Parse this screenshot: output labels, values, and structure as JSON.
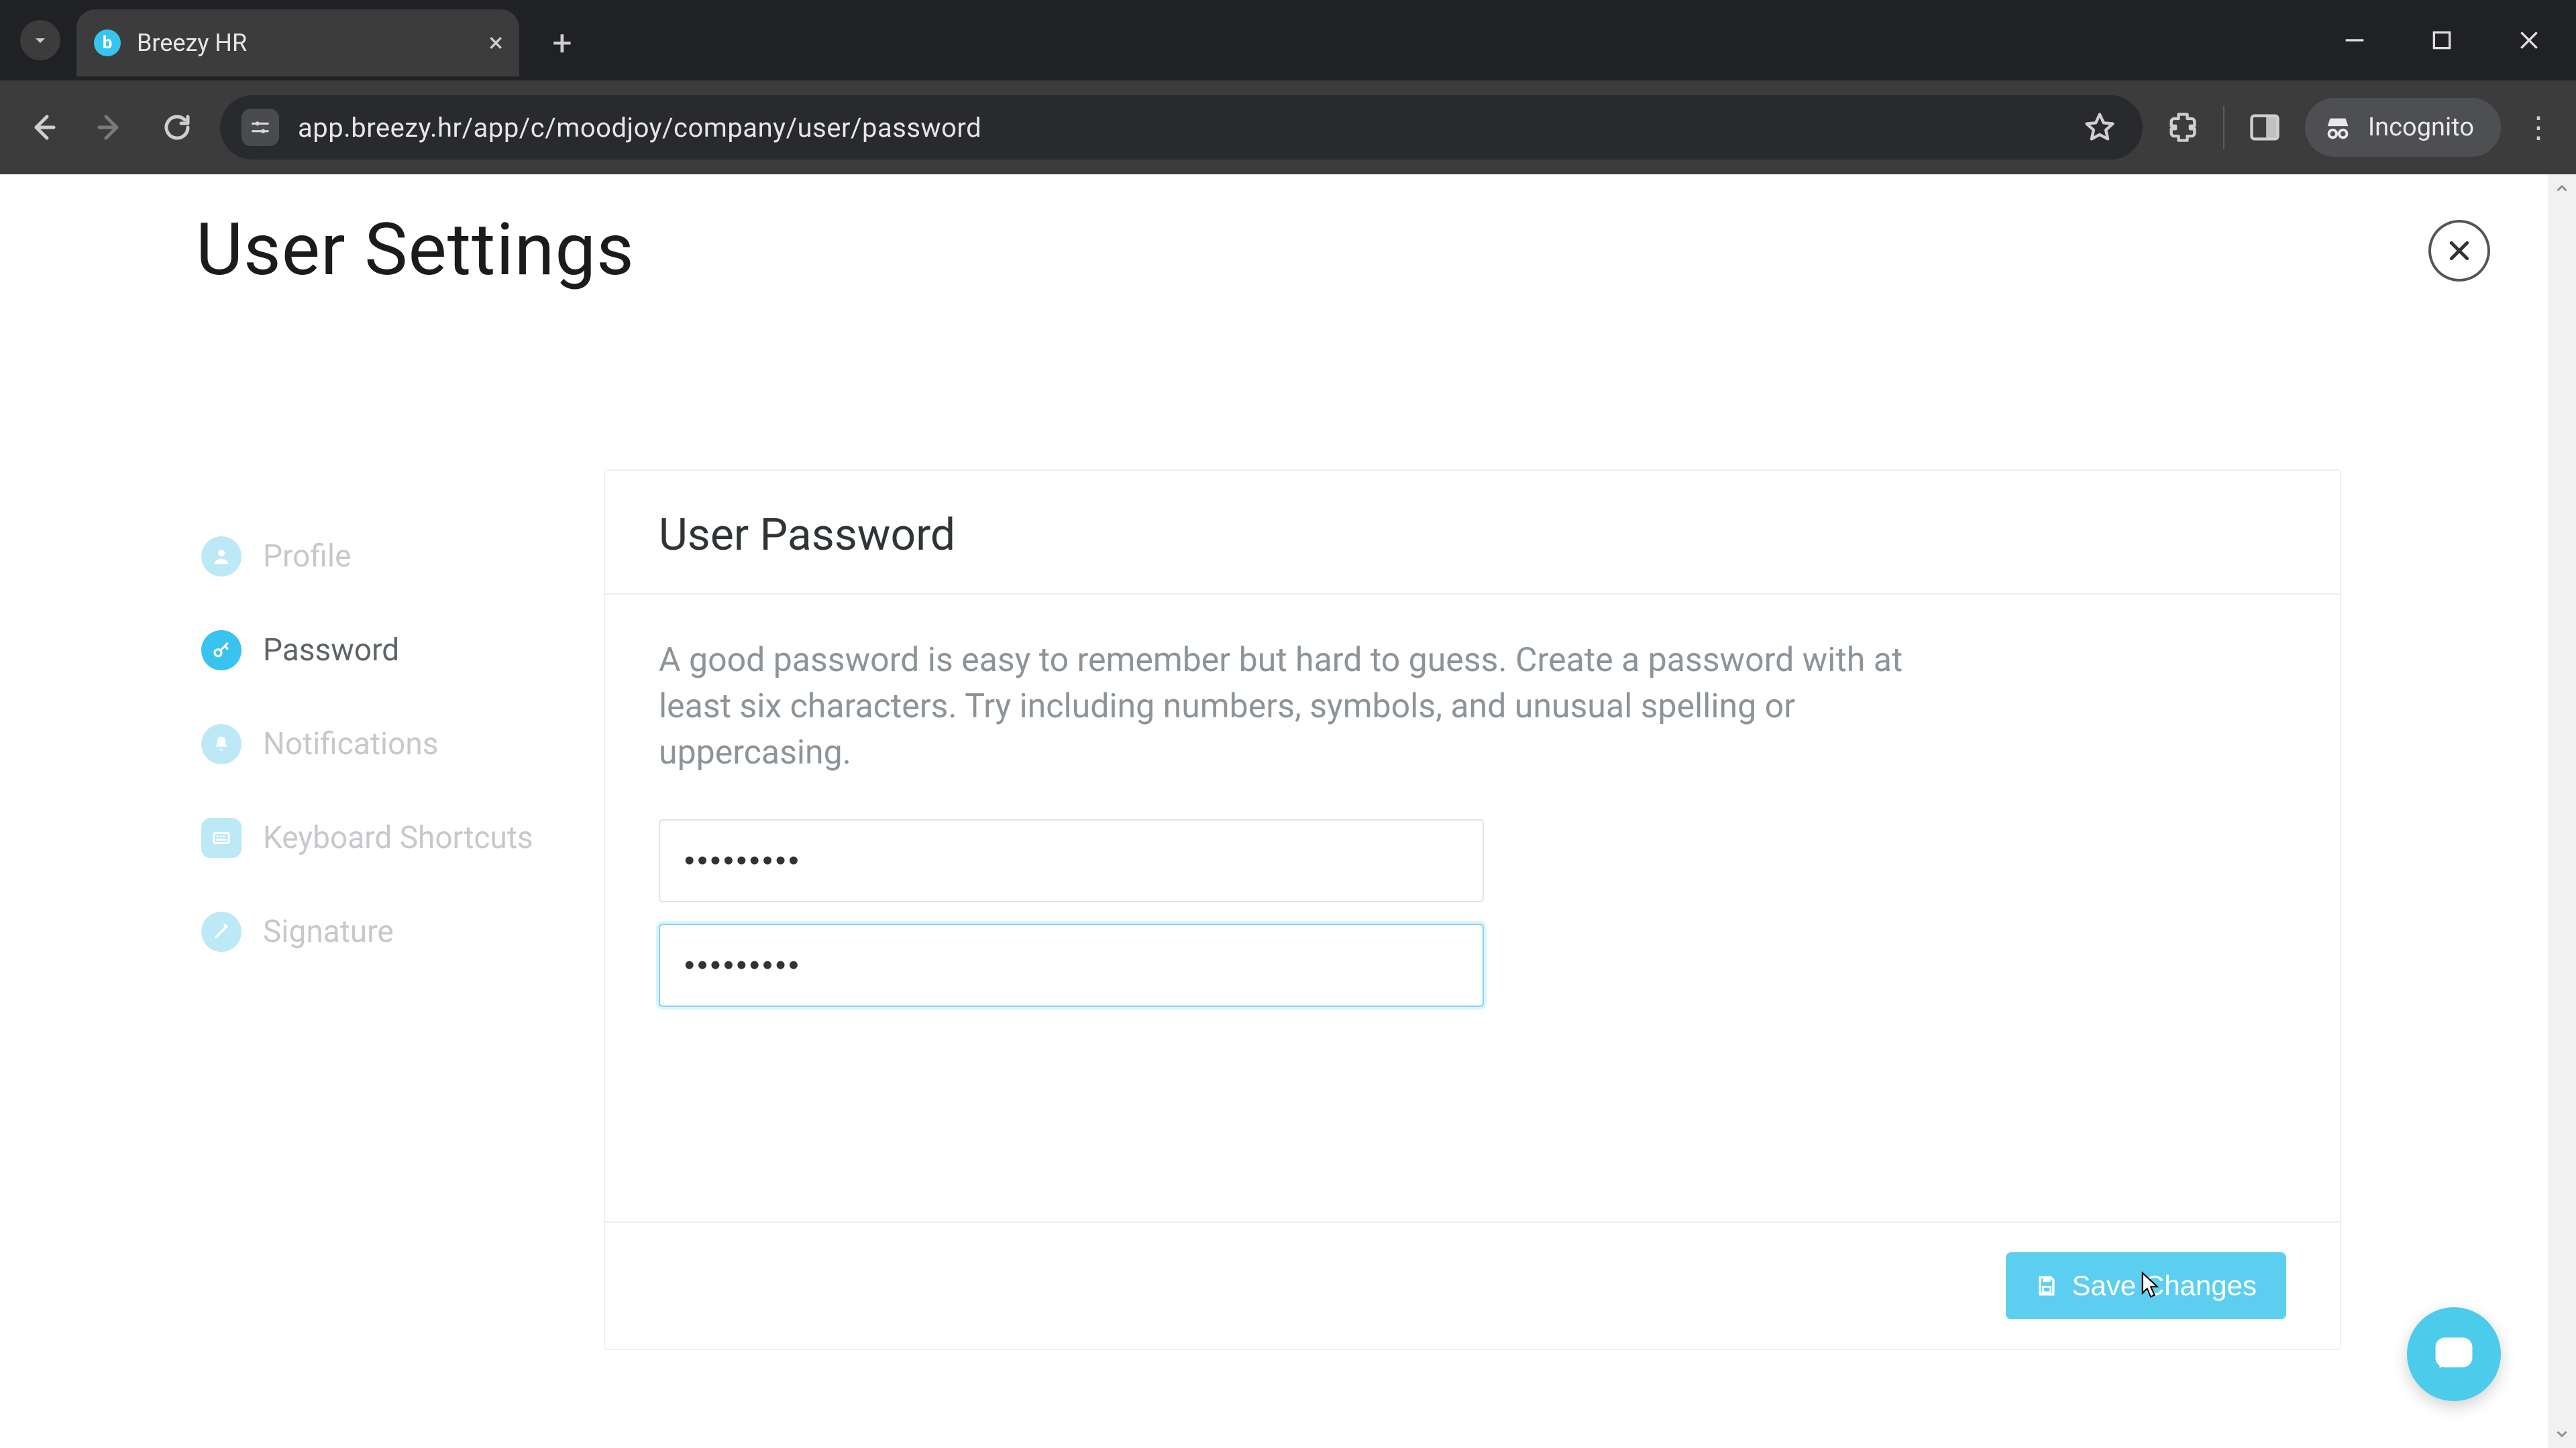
{
  "browser": {
    "tab_title": "Breezy HR",
    "url": "app.breezy.hr/app/c/moodjoy/company/user/password",
    "incognito_label": "Incognito"
  },
  "page": {
    "title": "User Settings"
  },
  "sidebar": {
    "items": [
      {
        "label": "Profile"
      },
      {
        "label": "Password"
      },
      {
        "label": "Notifications"
      },
      {
        "label": "Keyboard Shortcuts"
      },
      {
        "label": "Signature"
      }
    ]
  },
  "card": {
    "title": "User Password",
    "help_text": "A good password is easy to remember but hard to guess. Create a password with at least six characters. Try including numbers, symbols, and unusual spelling or uppercasing.",
    "password_value": "•••••••••",
    "confirm_value": "•••••••••",
    "save_label": "Save Changes"
  },
  "colors": {
    "accent": "#38c4ee",
    "accent_light": "#bde9f6"
  }
}
